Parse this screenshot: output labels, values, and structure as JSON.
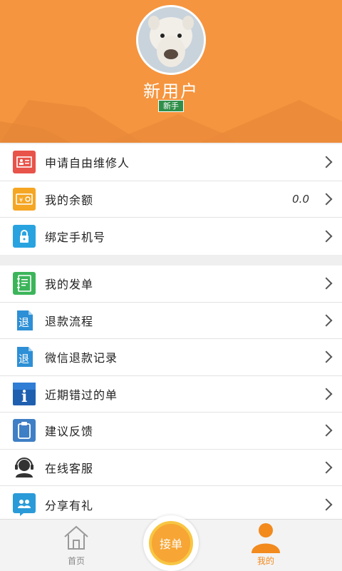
{
  "header": {
    "username": "新用户",
    "badge": "新手"
  },
  "menu_group1": [
    {
      "label": "申请自由维修人",
      "icon": "id-card-icon",
      "color": "#e8534a"
    },
    {
      "label": "我的余额",
      "icon": "wallet-icon",
      "color": "#f5a623",
      "value": "0.0"
    },
    {
      "label": "绑定手机号",
      "icon": "lock-icon",
      "color": "#29a3e0"
    }
  ],
  "menu_group2": [
    {
      "label": "我的发单",
      "icon": "notebook-icon",
      "color": "#3cb55a"
    },
    {
      "label": "退款流程",
      "icon": "refund-icon",
      "color": "#2d8fd5",
      "glyph": "退"
    },
    {
      "label": "微信退款记录",
      "icon": "refund-icon",
      "color": "#2d8fd5",
      "glyph": "退"
    },
    {
      "label": "近期错过的单",
      "icon": "info-icon",
      "color": "#1f5fb0",
      "glyph": "i"
    },
    {
      "label": "建议反馈",
      "icon": "clipboard-icon",
      "color": "#3f7fc5"
    },
    {
      "label": "在线客服",
      "icon": "headset-icon",
      "color": "#333333"
    },
    {
      "label": "分享有礼",
      "icon": "share-icon",
      "color": "#2a9bd8"
    }
  ],
  "tabbar": {
    "home_label": "首页",
    "center_label": "接单",
    "mine_label": "我的",
    "active_color": "#f28a1e",
    "inactive_color": "#888888"
  }
}
